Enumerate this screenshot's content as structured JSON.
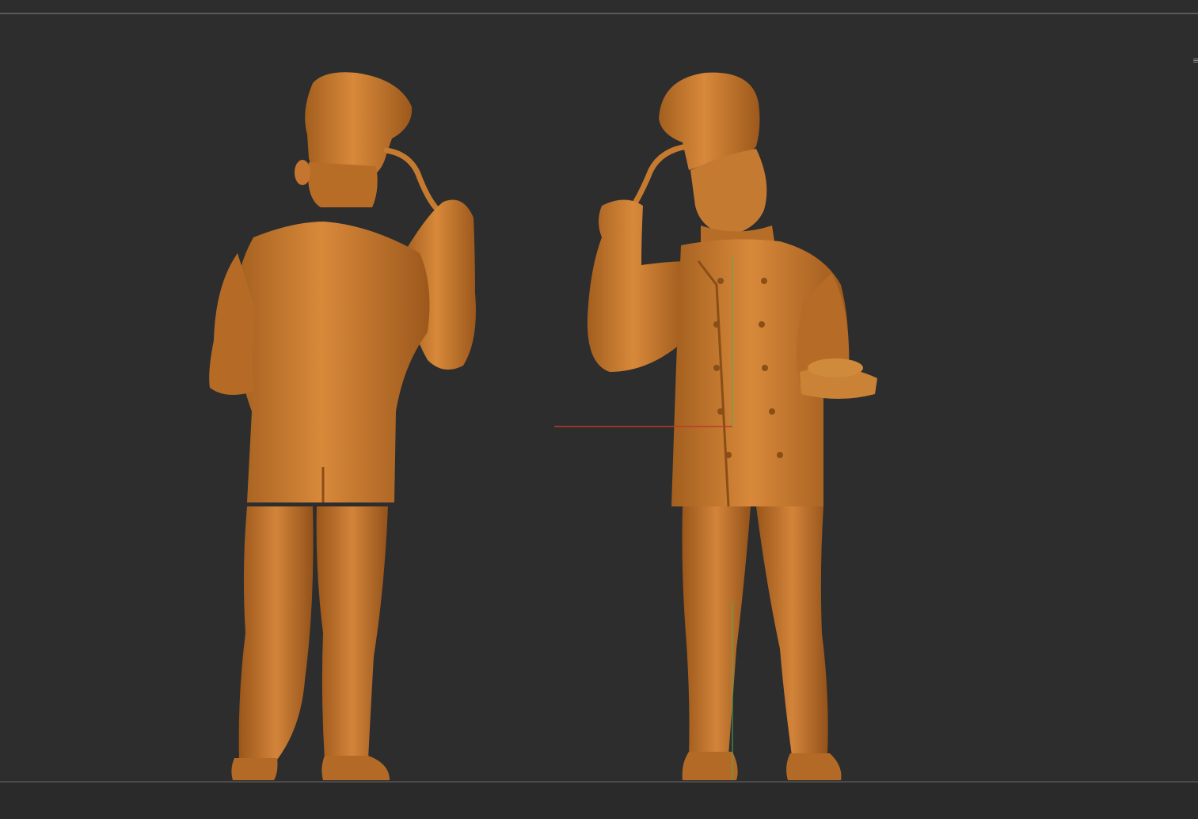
{
  "viewport": {
    "background": "#2d2d2d",
    "model_color": "#c67a2e",
    "model_highlight": "#e79a48",
    "model_shadow": "#8a4e17",
    "axis_x_color": "#c0392b",
    "axis_y_color": "#4caf50"
  },
  "models": [
    {
      "name": "chef-back-view"
    },
    {
      "name": "chef-front-view"
    }
  ]
}
